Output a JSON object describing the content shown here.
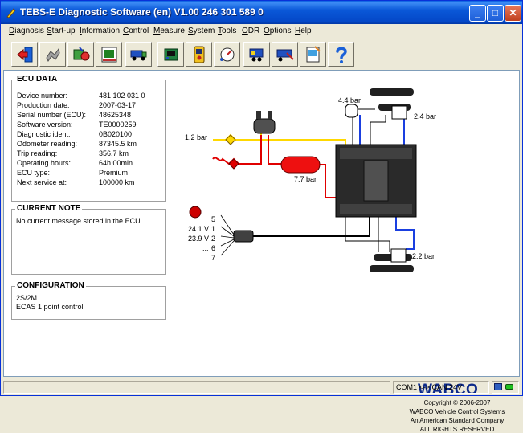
{
  "window": {
    "title": "TEBS-E Diagnostic Software (en) V1.00  246 301 589 0",
    "controls": {
      "minimize": "_",
      "maximize": "□",
      "close": "✕"
    }
  },
  "menu": [
    "Diagnosis",
    "Start-up",
    "Information",
    "Control",
    "Measure",
    "System",
    "Tools",
    "ODR",
    "Options",
    "Help"
  ],
  "toolbar": {
    "icons": [
      "exit-icon",
      "start-up-icon",
      "diagnosis-icon",
      "ecu-data-icon",
      "truck-control-icon",
      "ecu-icon",
      "display-icon",
      "measure-icon",
      "trailer-icon",
      "trailer-config-icon",
      "document-icon",
      "help-icon"
    ]
  },
  "ecu_data": {
    "title": "ECU DATA",
    "rows": [
      {
        "label": "Device number:",
        "value": "481 102 031 0"
      },
      {
        "label": "Production date:",
        "value": "2007-03-17"
      },
      {
        "label": "Serial number (ECU):",
        "value": "48625348"
      },
      {
        "label": "Software version:",
        "value": "TE0000259"
      },
      {
        "label": "Diagnostic ident:",
        "value": "0B020100"
      },
      {
        "label": "Odometer reading:",
        "value": "87345.5 km"
      },
      {
        "label": "Trip reading:",
        "value": "356.7 km"
      },
      {
        "label": "Operating hours:",
        "value": "64h 00min"
      },
      {
        "label": "ECU type:",
        "value": "Premium"
      },
      {
        "label": "Next service at:",
        "value": "100000 km"
      }
    ]
  },
  "current_note": {
    "title": "CURRENT NOTE",
    "text": "No current message stored in the ECU"
  },
  "configuration": {
    "title": "CONFIGURATION",
    "lines": [
      "2S/2M",
      "ECAS 1 point control"
    ]
  },
  "diagram": {
    "pressure_top": "4.4 bar",
    "pressure_right_top": "2.4 bar",
    "supply_pressure": "1.2 bar",
    "reservoir_pressure": "7.7 bar",
    "pressure_right_bottom": "2.2 bar",
    "pins": [
      "5",
      "1",
      "2",
      "6",
      "7"
    ],
    "voltages": [
      "24.1 V",
      "23.9 V",
      "...",
      ""
    ],
    "colors": {
      "supply": "#ffd800",
      "control": "#e00000",
      "sensor": "#1a3fe0",
      "wire": "#000000"
    }
  },
  "branding": {
    "logo": "WABCO",
    "copyright": "Copyright © 2006-2007",
    "company": "WABCO Vehicle Control Systems",
    "parent": "An American Standard Company",
    "rights": "ALL RIGHTS RESERVED"
  },
  "status": {
    "connection": "COM1 <-> CAN 24V"
  }
}
